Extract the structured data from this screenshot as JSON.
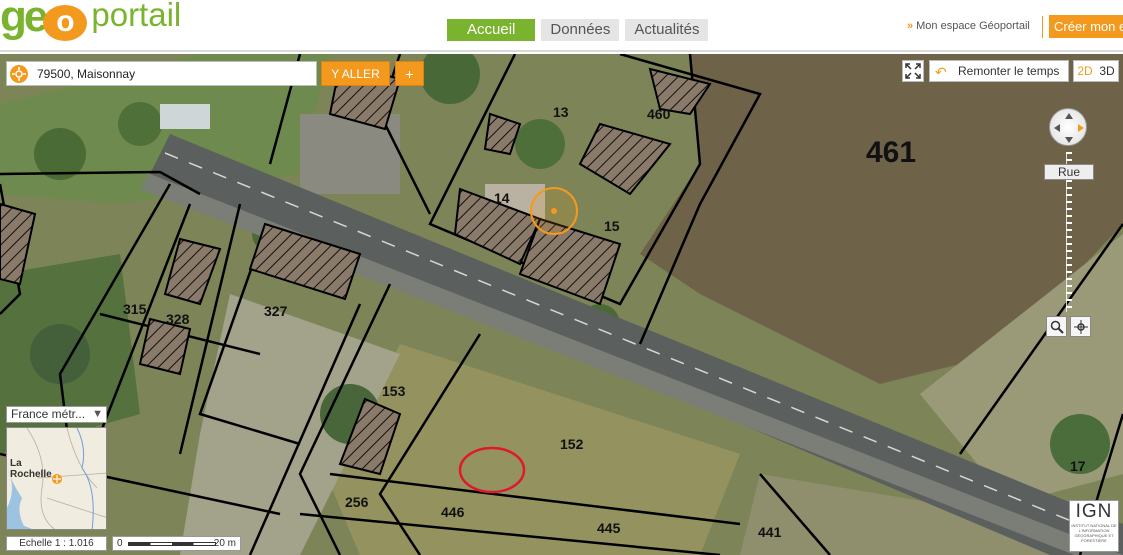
{
  "header": {
    "logo_geo": "ge",
    "logo_o": "o",
    "logo_portail": "portail",
    "nav": [
      {
        "label": "Accueil",
        "active": true
      },
      {
        "label": "Données",
        "active": false
      },
      {
        "label": "Actualités",
        "active": false
      }
    ],
    "espace_label": "Mon espace Géoportail",
    "espace_arrow": "»",
    "creer_label": "Créer mon e"
  },
  "search": {
    "value": "79500, Maisonnay",
    "yaller_label": "Y ALLER",
    "plus_label": "+"
  },
  "controls": {
    "remonter_label": "Remonter le temps",
    "view_2d": "2D",
    "view_3d": "3D",
    "rue_label": "Rue"
  },
  "overview": {
    "select_value": "France métr...",
    "city": "La Rochelle"
  },
  "scale": {
    "echelle_label": "Echelle 1 :  1.016",
    "bar_left": "0",
    "bar_right": "20 m"
  },
  "ign": {
    "title": "IGN",
    "subtitle": "INSTITUT NATIONAL DE L'INFORMATION GÉOGRAPHIQUE ET FORESTIÈRE"
  },
  "parcels": [
    "13",
    "460",
    "461",
    "14",
    "15",
    "315",
    "328",
    "327",
    "153",
    "152",
    "256",
    "446",
    "445",
    "441",
    "17"
  ],
  "colors": {
    "brand_green": "#7ab32e",
    "brand_orange": "#f39a1e",
    "marker_red": "#e0182d"
  }
}
